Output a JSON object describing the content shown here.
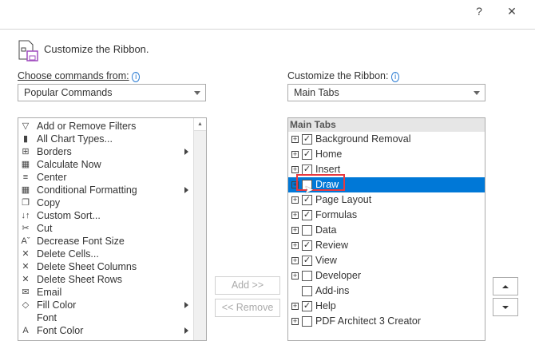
{
  "titlebar": {
    "help": "?",
    "close": "✕"
  },
  "header": {
    "title": "Customize the Ribbon."
  },
  "left": {
    "label": "Choose commands from:",
    "combo": "Popular Commands",
    "items": [
      {
        "label": "Add or Remove Filters",
        "icon": "filter-icon",
        "glyph": "▽",
        "sub": false
      },
      {
        "label": "All Chart Types...",
        "icon": "chart-icon",
        "glyph": "▮",
        "sub": false
      },
      {
        "label": "Borders",
        "icon": "borders-icon",
        "glyph": "⊞",
        "sub": true
      },
      {
        "label": "Calculate Now",
        "icon": "calculator-icon",
        "glyph": "▦",
        "sub": false
      },
      {
        "label": "Center",
        "icon": "center-align-icon",
        "glyph": "≡",
        "sub": false
      },
      {
        "label": "Conditional Formatting",
        "icon": "conditional-formatting-icon",
        "glyph": "▦",
        "sub": true
      },
      {
        "label": "Copy",
        "icon": "copy-icon",
        "glyph": "❐",
        "sub": false
      },
      {
        "label": "Custom Sort...",
        "icon": "sort-icon",
        "glyph": "↓↑",
        "sub": false
      },
      {
        "label": "Cut",
        "icon": "scissors-icon",
        "glyph": "✂",
        "sub": false
      },
      {
        "label": "Decrease Font Size",
        "icon": "decrease-font-icon",
        "glyph": "Aˇ",
        "sub": false
      },
      {
        "label": "Delete Cells...",
        "icon": "delete-cells-icon",
        "glyph": "✕",
        "sub": false
      },
      {
        "label": "Delete Sheet Columns",
        "icon": "delete-columns-icon",
        "glyph": "✕",
        "sub": false
      },
      {
        "label": "Delete Sheet Rows",
        "icon": "delete-rows-icon",
        "glyph": "✕",
        "sub": false
      },
      {
        "label": "Email",
        "icon": "email-icon",
        "glyph": "✉",
        "sub": false
      },
      {
        "label": "Fill Color",
        "icon": "fill-color-icon",
        "glyph": "◇",
        "sub": true
      },
      {
        "label": "Font",
        "icon": "font-icon",
        "glyph": "",
        "sub": false
      },
      {
        "label": "Font Color",
        "icon": "font-color-icon",
        "glyph": "A",
        "sub": true
      }
    ]
  },
  "right": {
    "label": "Customize the Ribbon:",
    "combo": "Main Tabs",
    "header": "Main Tabs",
    "items": [
      {
        "label": "Background Removal",
        "checked": true,
        "expand": true
      },
      {
        "label": "Home",
        "checked": true,
        "expand": true
      },
      {
        "label": "Insert",
        "checked": true,
        "expand": true
      },
      {
        "label": "Draw",
        "checked": false,
        "expand": true,
        "selected": true
      },
      {
        "label": "Page Layout",
        "checked": true,
        "expand": true
      },
      {
        "label": "Formulas",
        "checked": true,
        "expand": true
      },
      {
        "label": "Data",
        "checked": false,
        "expand": true
      },
      {
        "label": "Review",
        "checked": true,
        "expand": true
      },
      {
        "label": "View",
        "checked": true,
        "expand": true
      },
      {
        "label": "Developer",
        "checked": false,
        "expand": true
      },
      {
        "label": "Add-ins",
        "checked": false,
        "expand": false
      },
      {
        "label": "Help",
        "checked": true,
        "expand": true
      },
      {
        "label": "PDF Architect 3 Creator",
        "checked": false,
        "expand": true
      }
    ]
  },
  "buttons": {
    "add": "Add >>",
    "remove": "<< Remove"
  },
  "colors": {
    "selection": "#0078d7",
    "highlight": "#e8393f"
  }
}
